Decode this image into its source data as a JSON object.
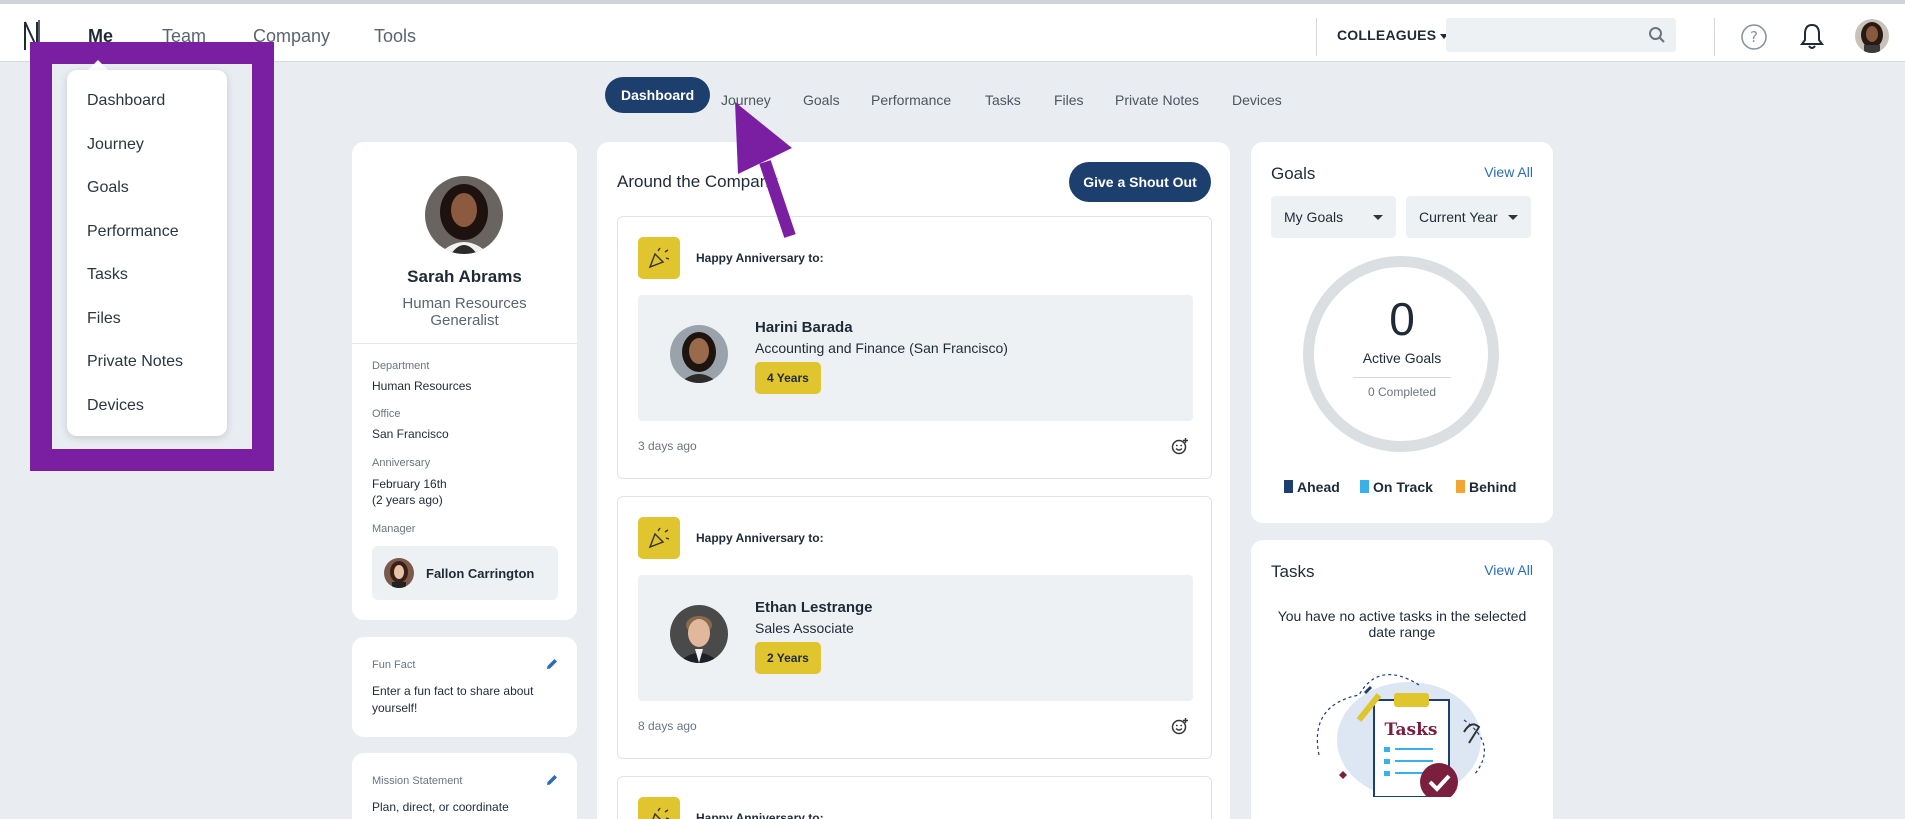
{
  "topnav": {
    "items": [
      "Me",
      "Team",
      "Company",
      "Tools"
    ],
    "colleagues_label": "COLLEAGUES",
    "search_placeholder": ""
  },
  "menu": {
    "items": [
      "Dashboard",
      "Journey",
      "Goals",
      "Performance",
      "Tasks",
      "Files",
      "Private Notes",
      "Devices"
    ]
  },
  "subtabs": [
    "Dashboard",
    "Journey",
    "Goals",
    "Performance",
    "Tasks",
    "Files",
    "Private Notes",
    "Devices"
  ],
  "profile": {
    "name": "Sarah Abrams",
    "title": "Human Resources Generalist",
    "department_label": "Department",
    "department": "Human Resources",
    "office_label": "Office",
    "office": "San Francisco",
    "anniversary_label": "Anniversary",
    "anniversary_date": "February 16th",
    "anniversary_years": "(2 years ago)",
    "manager_label": "Manager",
    "manager": "Fallon Carrington"
  },
  "fun_fact": {
    "label": "Fun Fact",
    "text": "Enter a fun fact to share about yourself!"
  },
  "mission": {
    "label": "Mission Statement",
    "text": "Plan, direct, or coordinate"
  },
  "feed": {
    "title": "Around the Company",
    "shout_out_label": "Give a Shout Out",
    "posts": [
      {
        "heading": "Happy Anniversary to:",
        "person": "Harini Barada",
        "dept": "Accounting and Finance (San Francisco)",
        "years": "4 Years",
        "time": "3 days ago"
      },
      {
        "heading": "Happy Anniversary to:",
        "person": "Ethan Lestrange",
        "dept": "Sales Associate",
        "years": "2 Years",
        "time": "8 days ago"
      },
      {
        "heading": "Happy Anniversary to:"
      }
    ]
  },
  "goals": {
    "title": "Goals",
    "view_all": "View All",
    "filter_goals": "My Goals",
    "filter_period": "Current Year",
    "active_count": "0",
    "active_label": "Active Goals",
    "completed": "0 Completed",
    "legend": [
      {
        "label": "Ahead",
        "color": "#1d3f6e"
      },
      {
        "label": "On Track",
        "color": "#3ab0e8"
      },
      {
        "label": "Behind",
        "color": "#f2a531"
      }
    ]
  },
  "tasks": {
    "title": "Tasks",
    "view_all": "View All",
    "empty_text": "You have no active tasks in the selected date range",
    "illustration_label": "Tasks"
  },
  "colors": {
    "accent": "#1d3f6e",
    "highlight": "#7b1fa2",
    "badge": "#e0c52f"
  }
}
